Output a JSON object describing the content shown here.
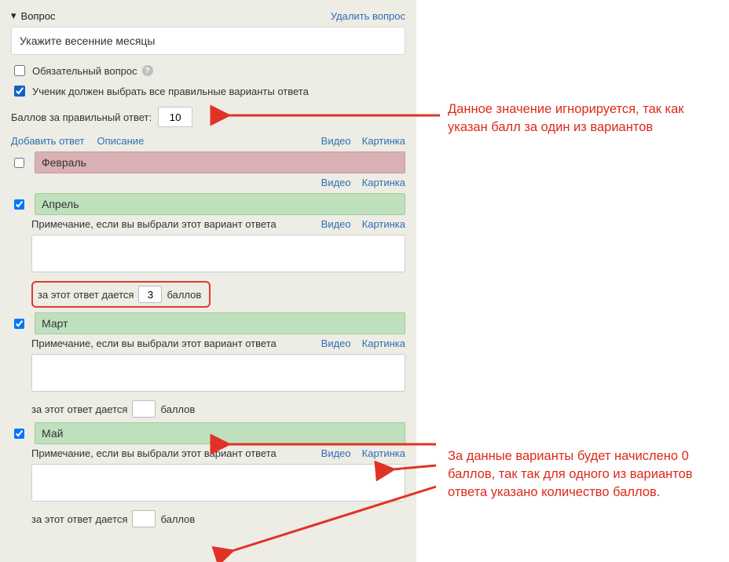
{
  "header": {
    "title": "Вопрос",
    "delete": "Удалить вопрос"
  },
  "question": {
    "placeholder": "",
    "value": "Укажите весенние месяцы"
  },
  "mandatory": {
    "label": "Обязательный вопрос",
    "checked": false
  },
  "allCorrect": {
    "label": "Ученик должен выбрать все правильные варианты ответа",
    "checked": true
  },
  "score": {
    "label": "Баллов за правильный ответ:",
    "value": "10"
  },
  "links": {
    "add": "Добавить ответ",
    "desc": "Описание",
    "video": "Видео",
    "image": "Картинка"
  },
  "note_label": "Примечание, если вы выбрали этот вариант ответа",
  "answer_score": {
    "prefix": "за этот ответ дается",
    "suffix": "баллов"
  },
  "answers": [
    {
      "text": "Февраль",
      "checked": false,
      "correct": false,
      "expanded": false
    },
    {
      "text": "Апрель",
      "checked": true,
      "correct": true,
      "expanded": true,
      "note": "",
      "points": "3",
      "highlight": true
    },
    {
      "text": "Март",
      "checked": true,
      "correct": true,
      "expanded": true,
      "note": "",
      "points": ""
    },
    {
      "text": "Май",
      "checked": true,
      "correct": true,
      "expanded": true,
      "note": "",
      "points": ""
    }
  ],
  "annotations": {
    "top": "Данное значение игнорируется, так как указан балл за один из вариантов",
    "bottom": "За данные варианты будет начислено 0 баллов, так так для одного из вариантов ответа указано количество баллов."
  }
}
